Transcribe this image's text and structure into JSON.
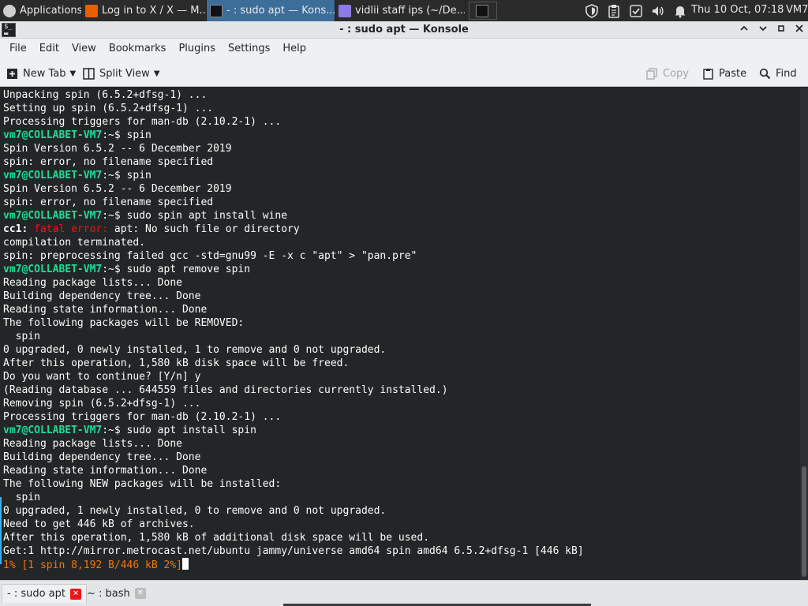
{
  "panel": {
    "tasks": [
      {
        "label": "Applications",
        "icon": "applications-menu-icon",
        "active": false
      },
      {
        "label": "Log in to X / X — M...",
        "icon": "firefox-icon",
        "active": false
      },
      {
        "label": "- : sudo apt — Kons...",
        "icon": "terminal-icon",
        "active": true
      },
      {
        "label": "vidlii staff ips (~/De...",
        "icon": "text-editor-icon",
        "active": false
      },
      {
        "label": "",
        "icon": "terminal-icon",
        "active": false
      }
    ],
    "clock": "Thu 10 Oct, 07:18",
    "vm_label": "VM7",
    "accent_color": "#3d6e9a"
  },
  "window": {
    "title": "- : sudo apt — Konsole",
    "controls": [
      "minimize-chevron-icon",
      "restore-icon",
      "close-icon"
    ]
  },
  "menubar": [
    "File",
    "Edit",
    "View",
    "Bookmarks",
    "Plugins",
    "Settings",
    "Help"
  ],
  "toolbar": {
    "new_tab": "New Tab",
    "split_view": "Split View",
    "copy": "Copy",
    "paste": "Paste",
    "find": "Find"
  },
  "terminal": {
    "prompt": "vm7@COLLABET-VM7",
    "prompt_suffix": ":~$ ",
    "lines": {
      "l01": "Unpacking spin (6.5.2+dfsg-1) ...",
      "l02": "Setting up spin (6.5.2+dfsg-1) ...",
      "l03": "Processing triggers for man-db (2.10.2-1) ...",
      "l04_cmd": "spin",
      "l05": "Spin Version 6.5.2 -- 6 December 2019",
      "l06": "spin: error, no filename specified",
      "l07_cmd": "spin",
      "l08": "Spin Version 6.5.2 -- 6 December 2019",
      "l09": "spin: error, no filename specified",
      "l10_cmd": "sudo spin apt install wine",
      "l11_a": "cc1:",
      "l11_b": "fatal error:",
      "l11_c": " apt: No such file or directory",
      "l12": "compilation terminated.",
      "l13": "spin: preprocessing failed gcc -std=gnu99 -E -x c \"apt\" > \"pan.pre\"",
      "l14_cmd": "sudo apt remove spin",
      "l15": "Reading package lists... Done",
      "l16": "Building dependency tree... Done",
      "l17": "Reading state information... Done",
      "l18": "The following packages will be REMOVED:",
      "l19": "  spin",
      "l20": "0 upgraded, 0 newly installed, 1 to remove and 0 not upgraded.",
      "l21": "After this operation, 1,580 kB disk space will be freed.",
      "l22": "Do you want to continue? [Y/n] y",
      "l23": "(Reading database ... 644559 files and directories currently installed.)",
      "l24": "Removing spin (6.5.2+dfsg-1) ...",
      "l25": "Processing triggers for man-db (2.10.2-1) ...",
      "l26_cmd": "sudo apt install spin",
      "l27": "Reading package lists... Done",
      "l28": "Building dependency tree... Done",
      "l29": "Reading state information... Done",
      "l30": "The following NEW packages will be installed:",
      "l31": "  spin",
      "l32": "0 upgraded, 1 newly installed, 0 to remove and 0 not upgraded.",
      "l33": "Need to get 446 kB of archives.",
      "l34": "After this operation, 1,580 kB of additional disk space will be used.",
      "l35": "Get:1 http://mirror.metrocast.net/ubuntu jammy/universe amd64 spin amd64 6.5.2+dfsg-1 [446 kB]",
      "l36": "1% [1 spin 8,192 B/446 kB 2%]"
    },
    "colors": {
      "background": "#232627",
      "foreground": "#fcfcfc",
      "prompt": "#1cdc9a",
      "error": "#ed1515",
      "progress": "#f67400"
    }
  },
  "tabs": [
    {
      "label": "- : sudo apt",
      "active": true
    },
    {
      "label": "~ : bash",
      "active": false
    }
  ]
}
